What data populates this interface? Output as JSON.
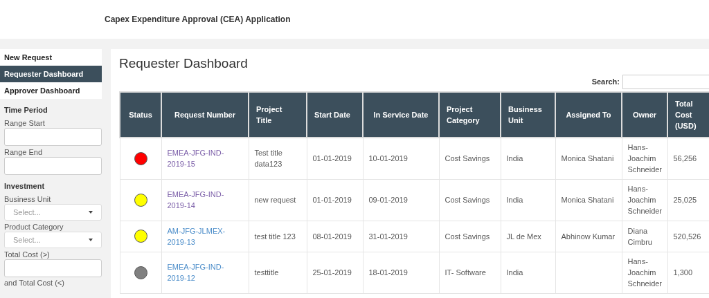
{
  "app_title": "Capex Expenditure Approval (CEA) Application",
  "nav": [
    {
      "label": "New Request",
      "selected": false
    },
    {
      "label": "Requester Dashboard",
      "selected": true
    },
    {
      "label": "Approver Dashboard",
      "selected": false
    }
  ],
  "filters": [
    {
      "kind": "heading",
      "label": "Time Period"
    },
    {
      "kind": "text",
      "label": "Range Start"
    },
    {
      "kind": "text",
      "label": "Range End"
    },
    {
      "kind": "heading",
      "label": "Investment"
    },
    {
      "kind": "select",
      "label": "Business Unit",
      "placeholder": "Select..."
    },
    {
      "kind": "select",
      "label": "Product Category",
      "placeholder": "Select..."
    },
    {
      "kind": "text",
      "label": "Total Cost (>)"
    },
    {
      "kind": "label",
      "label": "and Total Cost (<)"
    }
  ],
  "page_title": "Requester Dashboard",
  "search": {
    "label": "Search:"
  },
  "table": {
    "columns": [
      "Status",
      "Request Number",
      "Project Title",
      "Start Date",
      "In Service Date",
      "Project Category",
      "Business Unit",
      "Assigned To",
      "Owner",
      "Total Cost (USD)"
    ],
    "rows": [
      {
        "color": "#ff0000",
        "request_number": "EMEA-JFG-IND-2019-15",
        "visited": true,
        "title": "Test title data123",
        "start": "01-01-2019",
        "in_service": "10-01-2019",
        "category": "Cost Savings",
        "unit": "India",
        "assigned": "Monica Shatani",
        "owner": "Hans-Joachim Schneider",
        "cost": "56,256"
      },
      {
        "color": "#ffff00",
        "request_number": "EMEA-JFG-IND-2019-14",
        "visited": true,
        "title": "new request",
        "start": "01-01-2019",
        "in_service": "09-01-2019",
        "category": "Cost Savings",
        "unit": "India",
        "assigned": "Monica Shatani",
        "owner": "Hans-Joachim Schneider",
        "cost": "25,025"
      },
      {
        "color": "#ffff00",
        "request_number": "AM-JFG-JLMEX-2019-13",
        "visited": false,
        "title": "test title 123",
        "start": "08-01-2019",
        "in_service": "31-01-2019",
        "category": "Cost Savings",
        "unit": "JL de Mex",
        "assigned": "Abhinow Kumar",
        "owner": "Diana Cimbru",
        "cost": "520,526"
      },
      {
        "color": "#808080",
        "request_number": "EMEA-JFG-IND-2019-12",
        "visited": false,
        "title": "testtitle",
        "start": "25-01-2019",
        "in_service": "18-01-2019",
        "category": "IT- Software",
        "unit": "India",
        "owner": "Hans-Joachim Schneider",
        "cost": "1,300"
      }
    ]
  }
}
